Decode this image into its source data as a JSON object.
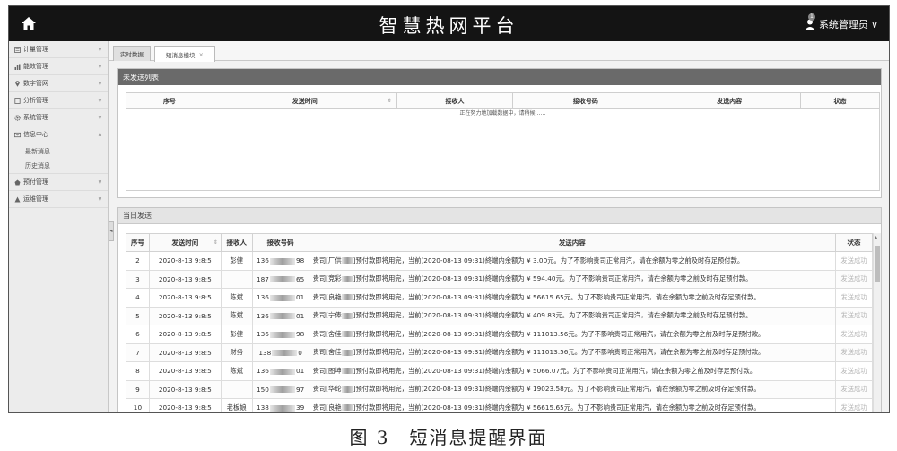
{
  "header": {
    "title": "智慧热网平台",
    "user_badge": "1",
    "user_name": "系统管理员",
    "user_chevron": "∨"
  },
  "sidebar": {
    "items": [
      {
        "label": "计量管理",
        "icon": "meter-icon",
        "chevron": "∨"
      },
      {
        "label": "能效管理",
        "icon": "chart-icon",
        "chevron": "∨"
      },
      {
        "label": "数字管网",
        "icon": "location-icon",
        "chevron": "∨"
      },
      {
        "label": "分析管理",
        "icon": "analysis-icon",
        "chevron": "∨"
      },
      {
        "label": "系统管理",
        "icon": "gear-icon",
        "chevron": "∨"
      },
      {
        "label": "信息中心",
        "icon": "message-icon",
        "chevron": "∧"
      }
    ],
    "sub_items": [
      {
        "label": "最新消息"
      },
      {
        "label": "历史消息"
      }
    ],
    "items_after": [
      {
        "label": "预付管理",
        "icon": "prepay-icon",
        "chevron": "∨"
      },
      {
        "label": "运维管理",
        "icon": "maintenance-icon",
        "chevron": "∨"
      }
    ],
    "collapse_glyph": "◂"
  },
  "tabs": [
    {
      "label": "实时数据"
    },
    {
      "label": "短消息模块",
      "close": "×"
    }
  ],
  "unsent": {
    "title": "未发送列表",
    "columns": [
      "序号",
      "发送时间",
      "接收人",
      "接收号码",
      "发送内容",
      "状态"
    ],
    "loading": "正在努力地加载数据中，请稍候……"
  },
  "today": {
    "title": "当日发送",
    "columns": [
      "序号",
      "发送时间",
      "接收人",
      "接收号码",
      "发送内容",
      "状态"
    ],
    "rows": [
      {
        "no": "2",
        "time": "2020-8-13 9:8:5",
        "receiver": "彭健",
        "phone_prefix": "136",
        "phone_suffix": "98",
        "company_pre": "贵司[厂供",
        "company_post": "]预付款即将用完，当前(2020-08-13 09:31)終端内余额为 ¥ 3.00元。为了不影响贵司正常用汽，请在余额为零之前及时存足预付款。",
        "status": "发送成功"
      },
      {
        "no": "3",
        "time": "2020-8-13 9:8:5",
        "receiver": "",
        "phone_prefix": "187",
        "phone_suffix": "65",
        "company_pre": "贵司[竞彩",
        "company_post": "]预付款即将用完，当前(2020-08-13 09:31)終端内余额为 ¥ 594.40元。为了不影响贵司正常用汽，请在余额为零之前及时存足预付款。",
        "status": "发送成功"
      },
      {
        "no": "4",
        "time": "2020-8-13 9:8:5",
        "receiver": "陈斌",
        "phone_prefix": "136",
        "phone_suffix": "01",
        "company_pre": "贵司[良艳",
        "company_post": "]预付款即将用完，当前(2020-08-13 09:31)終端内余额为 ¥ 56615.65元。为了不影响贵司正常用汽，请在余额为零之前及时存足预付款。",
        "status": "发送成功"
      },
      {
        "no": "5",
        "time": "2020-8-13 9:8:5",
        "receiver": "陈斌",
        "phone_prefix": "136",
        "phone_suffix": "01",
        "company_pre": "贵司[宁俸",
        "company_post": "]预付款即将用完，当前(2020-08-13 09:31)終端内余额为 ¥ 409.83元。为了不影响贵司正常用汽，请在余额为零之前及时存足预付款。",
        "status": "发送成功"
      },
      {
        "no": "6",
        "time": "2020-8-13 9:8:5",
        "receiver": "彭健",
        "phone_prefix": "136",
        "phone_suffix": "98",
        "company_pre": "贵司[舍佳",
        "company_post": "]预付款即将用完，当前(2020-08-13 09:31)終端内余额为 ¥ 111013.56元。为了不影响贵司正常用汽，请在余额为零之前及时存足预付款。",
        "status": "发送成功"
      },
      {
        "no": "7",
        "time": "2020-8-13 9:8:5",
        "receiver": "财务",
        "phone_prefix": "138",
        "phone_suffix": "0",
        "company_pre": "贵司[舍佳",
        "company_post": "]预付款即将用完，当前(2020-08-13 09:31)終端内余额为 ¥ 111013.56元。为了不影响贵司正常用汽，请在余额为零之前及时存足预付款。",
        "status": "发送成功"
      },
      {
        "no": "8",
        "time": "2020-8-13 9:8:5",
        "receiver": "陈斌",
        "phone_prefix": "136",
        "phone_suffix": "01",
        "company_pre": "贵司[图坤",
        "company_post": "]预付款即将用完，当前(2020-08-13 09:31)終端内余额为 ¥ 5066.07元。为了不影响贵司正常用汽，请在余额为零之前及时存足预付款。",
        "status": "发送成功"
      },
      {
        "no": "9",
        "time": "2020-8-13 9:8:5",
        "receiver": "",
        "phone_prefix": "150",
        "phone_suffix": "97",
        "company_pre": "贵司[华纶",
        "company_post": "]预付款即将用完，当前(2020-08-13 09:31)終端内余额为 ¥ 19023.58元。为了不影响贵司正常用汽，请在余额为零之前及时存足预付款。",
        "status": "发送成功"
      },
      {
        "no": "10",
        "time": "2020-8-13 9:8:5",
        "receiver": "老板娘",
        "phone_prefix": "138",
        "phone_suffix": "39",
        "company_pre": "贵司[良艳",
        "company_post": "]预付款即将用完，当前(2020-08-13 09:31)終端内余额为 ¥ 56615.65元。为了不影响贵司正常用汽，请在余额为零之前及时存足预付款。",
        "status": "发送成功"
      }
    ]
  },
  "caption": "图 3　短消息提醒界面"
}
